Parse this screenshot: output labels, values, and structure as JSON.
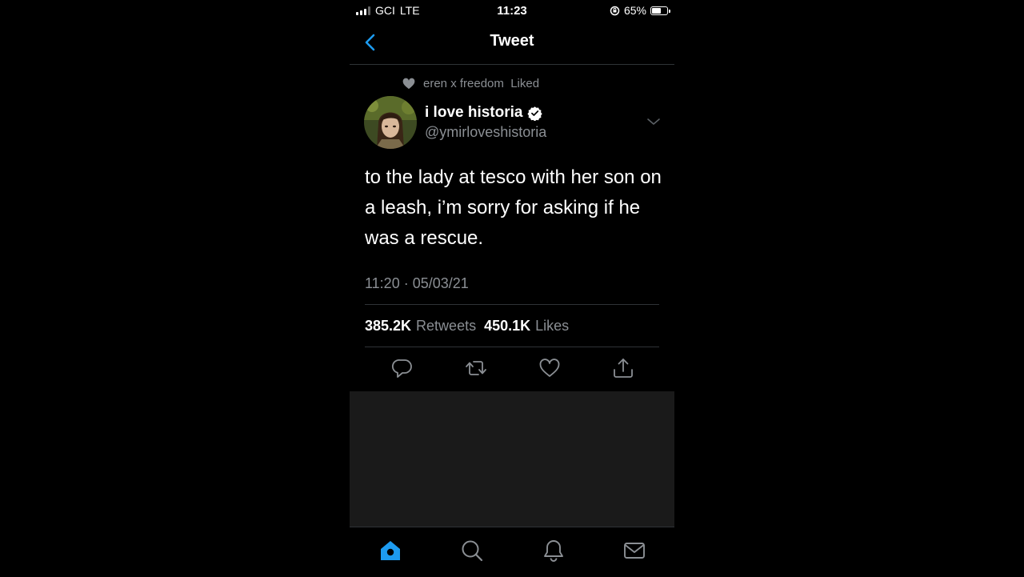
{
  "status_bar": {
    "carrier": "GCI",
    "network": "LTE",
    "time": "11:23",
    "battery": "65%",
    "battery_level": 0.65
  },
  "header": {
    "title": "Tweet"
  },
  "tweet": {
    "social_context": "eren x freedom  Liked",
    "author_name": "i love historia",
    "author_handle": "@ymirloveshistoria",
    "text": "to the lady at tesco with her son on a leash, i’m sorry for asking if he was a rescue.",
    "timestamp": "11:20 · 05/03/21",
    "retweet_count": "385.2K",
    "retweet_label": "Retweets",
    "like_count": "450.1K",
    "like_label": "Likes"
  },
  "icons": {
    "back": "chevron-left-icon",
    "verified": "verified-badge-icon",
    "caret": "chevron-down-icon",
    "reply": "reply-icon",
    "retweet": "retweet-icon",
    "like": "heart-icon",
    "share": "share-icon",
    "home": "home-icon",
    "search": "search-icon",
    "notifications": "bell-icon",
    "messages": "mail-icon"
  },
  "colors": {
    "accent": "#1d9bf0",
    "muted": "#8b8f94",
    "background": "#000000"
  }
}
